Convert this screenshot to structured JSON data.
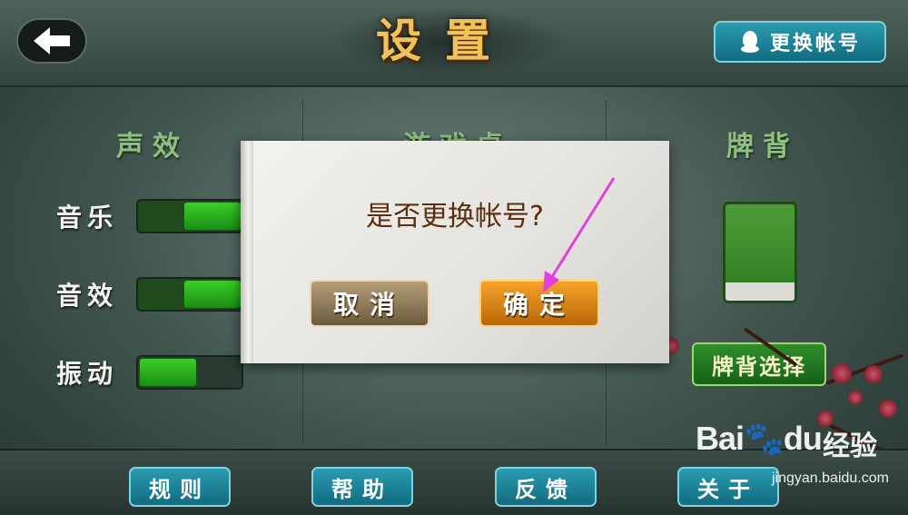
{
  "header": {
    "title": "设置",
    "back_icon": "arrow-left-icon",
    "switch_account_label": "更换帐号",
    "switch_account_icon": "qq-penguin-icon"
  },
  "sections": {
    "sound": {
      "title": "声效",
      "settings": [
        {
          "label": "音乐",
          "enabled": true
        },
        {
          "label": "音效",
          "enabled": true
        },
        {
          "label": "振动",
          "enabled": false
        }
      ]
    },
    "table": {
      "title": "游戏桌"
    },
    "card_back": {
      "title": "牌背",
      "select_label": "牌背选择"
    }
  },
  "bottom_nav": [
    "规则",
    "帮助",
    "反馈",
    "关于"
  ],
  "dialog": {
    "message": "是否更换帐号?",
    "cancel_label": "取消",
    "confirm_label": "确定"
  },
  "annotation": {
    "arrow_color": "#e040e0"
  },
  "watermark": {
    "logo": "Bai",
    "logo_suffix": "du",
    "text": "经验",
    "url": "jingyan.baidu.com"
  },
  "colors": {
    "accent_teal": "#1a8aa0",
    "toggle_green": "#2fb01f",
    "title_gold": "#f2c25a"
  }
}
